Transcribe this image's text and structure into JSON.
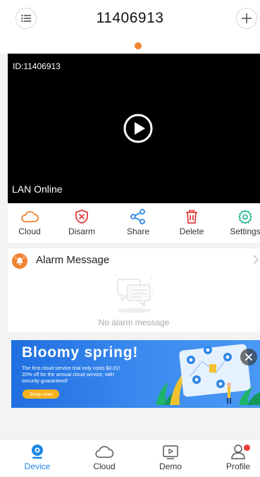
{
  "header": {
    "title": "11406913",
    "menu_icon": "list-menu-icon",
    "add_icon": "plus-icon"
  },
  "camera": {
    "id_label": "ID:11406913",
    "status": "LAN Online",
    "play_icon": "play-icon"
  },
  "toolbar": {
    "items": [
      {
        "label": "Cloud",
        "icon": "cloud-icon",
        "color": "#f08432"
      },
      {
        "label": "Disarm",
        "icon": "shield-x-icon",
        "color": "#e53e3e"
      },
      {
        "label": "Share",
        "icon": "share-icon",
        "color": "#2d86e8"
      },
      {
        "label": "Delete",
        "icon": "trash-icon",
        "color": "#e53e3e"
      },
      {
        "label": "Settings",
        "icon": "gear-icon",
        "color": "#19b38a"
      }
    ]
  },
  "alarm": {
    "title": "Alarm Message",
    "empty_text": "No alarm message"
  },
  "banner": {
    "title": "Bloomy spring!",
    "line1": "The first cloud service trial only costs $0.01!",
    "line2": "20% off for the annual cloud service, with",
    "line3": " security guaranteed!",
    "button": "Shop now"
  },
  "bottom_nav": {
    "items": [
      {
        "label": "Device",
        "icon": "device-icon",
        "active": true
      },
      {
        "label": "Cloud",
        "icon": "cloud-icon",
        "active": false
      },
      {
        "label": "Demo",
        "icon": "video-play-icon",
        "active": false
      },
      {
        "label": "Profile",
        "icon": "profile-icon",
        "active": false
      }
    ]
  },
  "colors": {
    "accent_blue": "#1a87e8",
    "pager_dot": "#f08432",
    "notification_dot": "#ef3b3b"
  }
}
